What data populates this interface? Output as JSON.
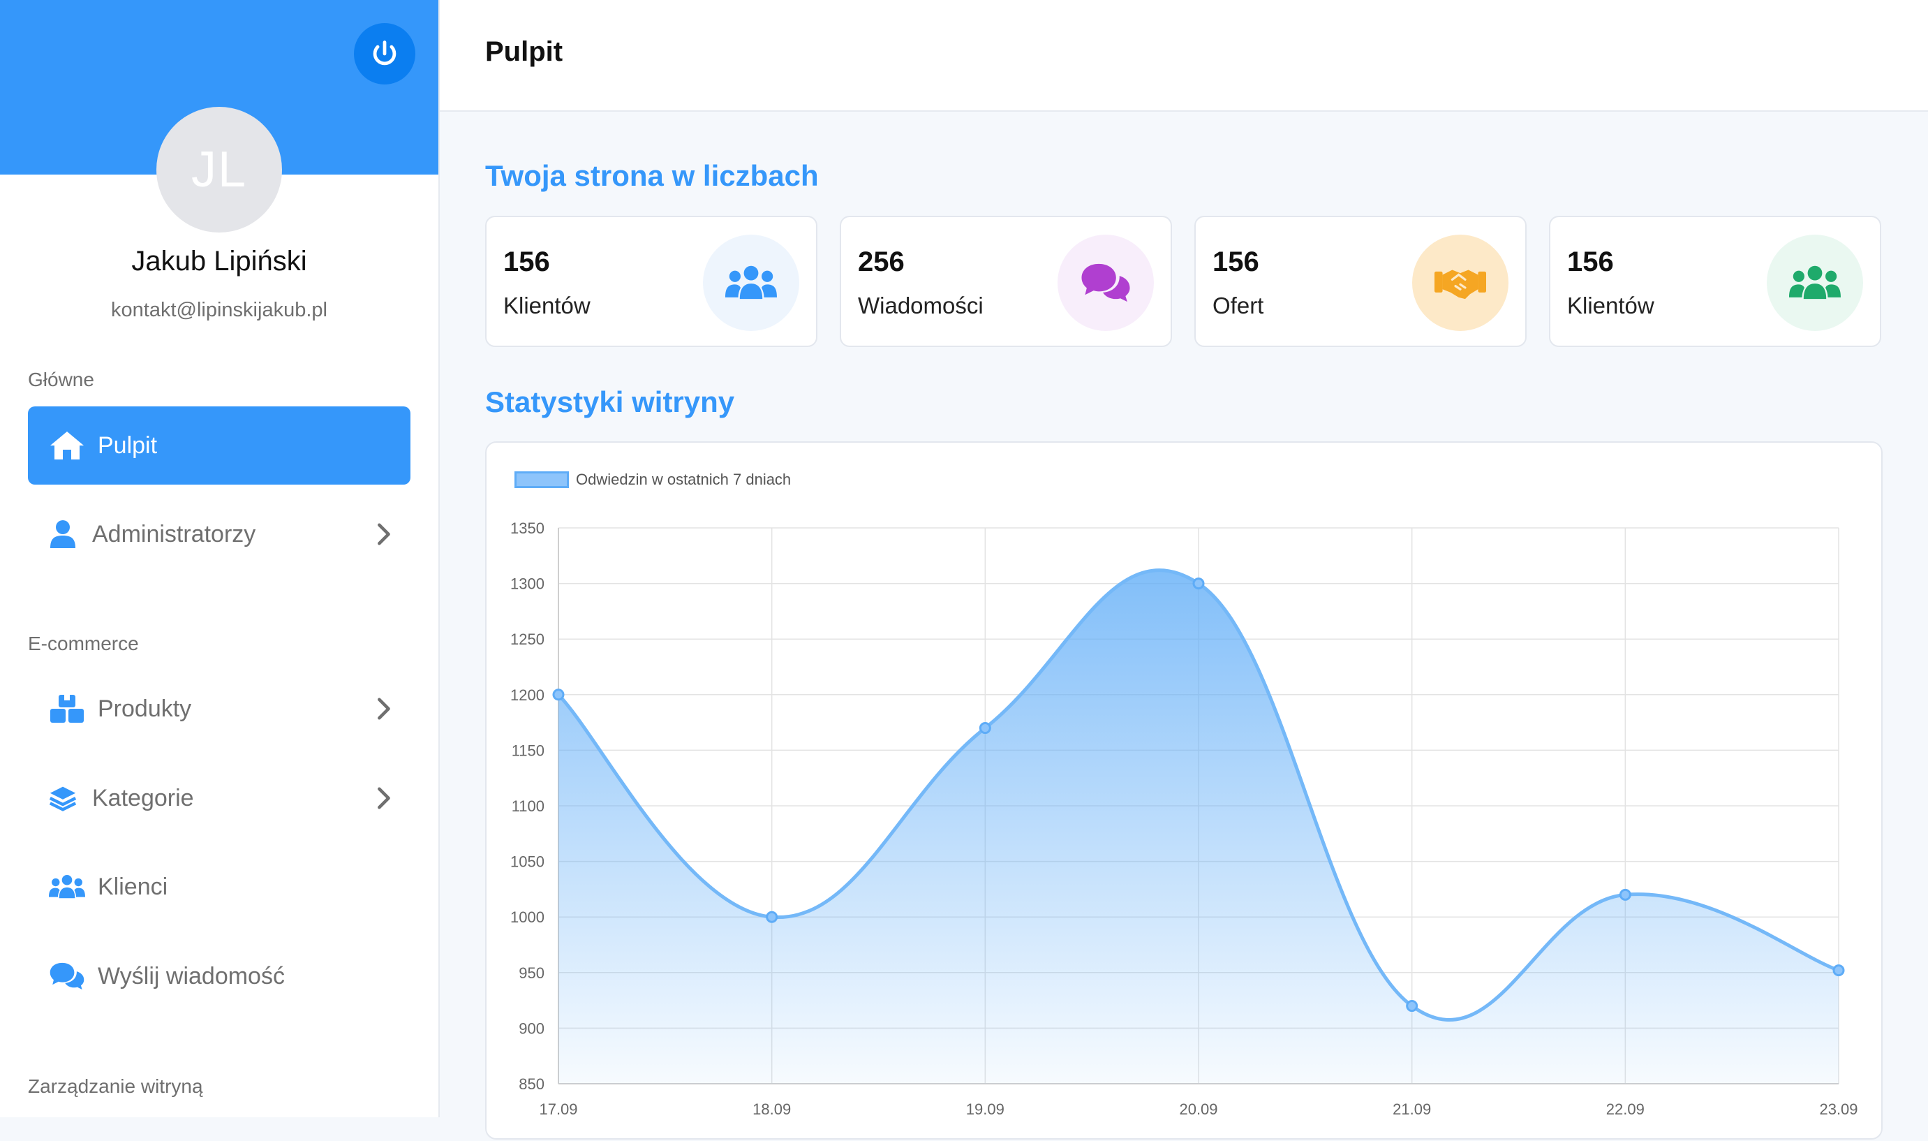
{
  "sidebar": {
    "avatar_initials": "JL",
    "user_name": "Jakub Lipiński",
    "user_email": "kontakt@lipinskijakub.pl",
    "sections": {
      "main": "Główne",
      "ecommerce": "E-commerce",
      "site": "Zarządzanie witryną"
    },
    "items": [
      {
        "label": "Pulpit",
        "icon": "home-icon",
        "active": true
      },
      {
        "label": "Administratorzy",
        "icon": "user-icon",
        "has_submenu": true
      },
      {
        "label": "Produkty",
        "icon": "boxes-icon",
        "has_submenu": true
      },
      {
        "label": "Kategorie",
        "icon": "layers-icon",
        "has_submenu": true
      },
      {
        "label": "Klienci",
        "icon": "users-icon"
      },
      {
        "label": "Wyślij wiadomość",
        "icon": "chat-icon"
      }
    ]
  },
  "header": {
    "title": "Pulpit"
  },
  "main": {
    "stats_title": "Twoja strona w liczbach",
    "chart_title": "Statystyki witryny",
    "stats": [
      {
        "value": "156",
        "label": "Klientów",
        "icon": "users-icon",
        "color": "#3597fa",
        "bg": "#eef5fd"
      },
      {
        "value": "256",
        "label": "Wiadomości",
        "icon": "chat-icon",
        "color": "#b03fd0",
        "bg": "#f8eefb"
      },
      {
        "value": "156",
        "label": "Ofert",
        "icon": "handshake-icon",
        "color": "#f5a623",
        "bg": "#fde9c8"
      },
      {
        "value": "156",
        "label": "Klientów",
        "icon": "users-icon",
        "color": "#1faa6b",
        "bg": "#eaf8f1"
      }
    ]
  },
  "colors": {
    "accent": "#3597fa",
    "line": "#74b8f8",
    "fill": "#8dc4fb"
  },
  "chart_data": {
    "type": "area",
    "legend": "Odwiedzin w ostatnich 7 dniach",
    "legend_position": "top-left",
    "categories": [
      "17.09",
      "18.09",
      "19.09",
      "20.09",
      "21.09",
      "22.09",
      "23.09"
    ],
    "series": [
      {
        "name": "Odwiedzin w ostatnich 7 dniach",
        "values": [
          1200,
          1000,
          1170,
          1300,
          920,
          1020,
          952
        ]
      }
    ],
    "ylim": [
      850,
      1350
    ],
    "yticks": [
      850,
      900,
      950,
      1000,
      1050,
      1100,
      1150,
      1200,
      1250,
      1300,
      1350
    ],
    "grid": true,
    "xlabel": "",
    "ylabel": ""
  }
}
